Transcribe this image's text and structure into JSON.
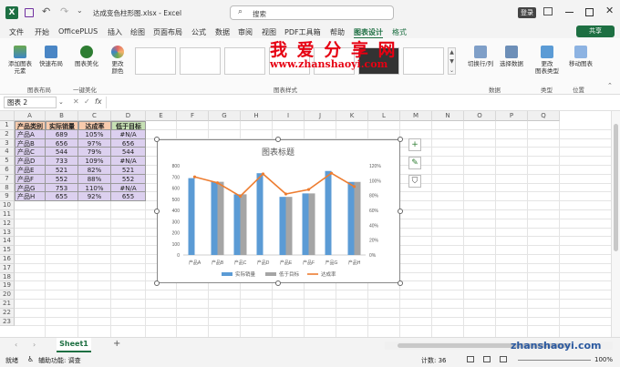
{
  "titlebar": {
    "autosave": "自动保存",
    "filename": "达成变色柱形图.xlsx - Excel",
    "search_placeholder": "搜索",
    "login": "登录"
  },
  "tabs": [
    "文件",
    "开始",
    "OfficePLUS",
    "插入",
    "绘图",
    "页面布局",
    "公式",
    "数据",
    "审阅",
    "视图",
    "PDF工具箱",
    "帮助",
    "图表设计",
    "格式"
  ],
  "share": "共享",
  "ribbon": {
    "add_element": "添加图表\n元素",
    "quick_layout": "快速布局",
    "chart_beautify": "图表美化",
    "change_colors": "更改\n颜色",
    "group_layout": "图表布局",
    "group_beautify": "一键美化",
    "group_styles": "图表样式",
    "switch_rowcol": "切换行/列",
    "select_data": "选择数据",
    "group_data": "数据",
    "change_type": "更改\n图表类型",
    "group_type": "类型",
    "move_chart": "移动图表",
    "group_location": "位置"
  },
  "watermark": {
    "title": "我 爱 分 享 网",
    "url": "www.zhanshaoyi.com"
  },
  "formula_bar": {
    "name_box": "图表 2",
    "fx": "fx"
  },
  "columns": [
    "A",
    "B",
    "C",
    "D",
    "E",
    "F",
    "G",
    "H",
    "I",
    "J",
    "K",
    "L",
    "M",
    "N",
    "O",
    "P",
    "Q"
  ],
  "rows": [
    "1",
    "2",
    "3",
    "4",
    "5",
    "6",
    "7",
    "8",
    "9",
    "10",
    "11",
    "12",
    "13",
    "14",
    "15",
    "16",
    "17",
    "18",
    "19",
    "20",
    "21",
    "22",
    "23"
  ],
  "table": {
    "headers": [
      "产品类别",
      "实际销量",
      "达成率",
      "低于目标"
    ],
    "rows": [
      [
        "产品A",
        "689",
        "105%",
        "#N/A"
      ],
      [
        "产品B",
        "656",
        "97%",
        "656"
      ],
      [
        "产品C",
        "544",
        "79%",
        "544"
      ],
      [
        "产品D",
        "733",
        "109%",
        "#N/A"
      ],
      [
        "产品E",
        "521",
        "82%",
        "521"
      ],
      [
        "产品F",
        "552",
        "88%",
        "552"
      ],
      [
        "产品G",
        "753",
        "110%",
        "#N/A"
      ],
      [
        "产品H",
        "655",
        "92%",
        "655"
      ]
    ]
  },
  "chart_data": {
    "type": "bar",
    "title": "图表标题",
    "categories": [
      "产品A",
      "产品B",
      "产品C",
      "产品D",
      "产品E",
      "产品F",
      "产品G",
      "产品H"
    ],
    "series": [
      {
        "name": "实际销量",
        "kind": "bar",
        "axis": "left",
        "values": [
          689,
          656,
          544,
          733,
          521,
          552,
          753,
          655
        ],
        "color": "#5b9bd5"
      },
      {
        "name": "低于目标",
        "kind": "bar",
        "axis": "left",
        "values": [
          null,
          656,
          544,
          null,
          521,
          552,
          null,
          655
        ],
        "color": "#a5a5a5"
      },
      {
        "name": "达成率",
        "kind": "line",
        "axis": "right",
        "values": [
          1.05,
          0.97,
          0.79,
          1.09,
          0.82,
          0.88,
          1.1,
          0.92
        ],
        "color": "#ed7d31"
      }
    ],
    "y_left": {
      "min": 0,
      "max": 800,
      "step": 100,
      "ticks": [
        "0",
        "100",
        "200",
        "300",
        "400",
        "500",
        "600",
        "700",
        "800"
      ]
    },
    "y_right": {
      "min": 0,
      "max": 1.2,
      "step": 0.2,
      "ticks": [
        "0%",
        "20%",
        "40%",
        "60%",
        "80%",
        "100%",
        "120%"
      ]
    },
    "grid": false,
    "legend": "bottom"
  },
  "sheet": {
    "tab": "Sheet1",
    "add": "+"
  },
  "status": {
    "ready": "就绪",
    "accessibility": "辅助功能: 调查",
    "count": "计数: 36",
    "zoom": "100%"
  },
  "watermark_bottom": "zhanshaoyi.com"
}
